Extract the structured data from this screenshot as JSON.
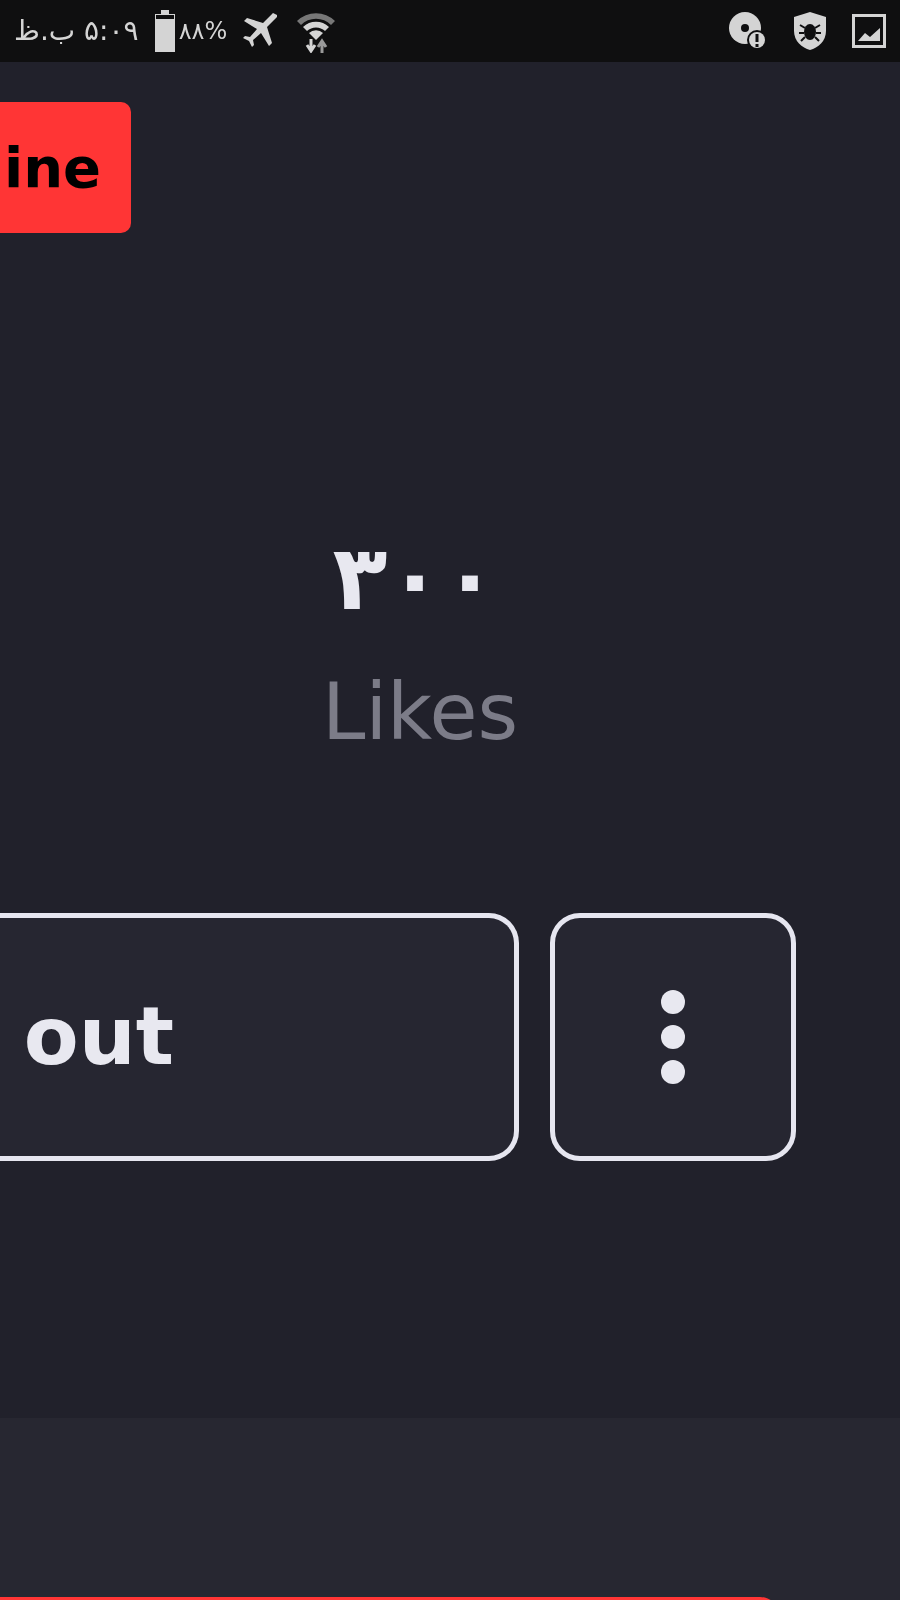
{
  "status_bar": {
    "time": "۵:۰۹ ب.ظ",
    "battery": {
      "text": "۸۸%",
      "level": 0.88
    }
  },
  "tag": {
    "label": "ine"
  },
  "stats": {
    "value": "۳۰۰",
    "label": "Likes"
  },
  "buttons": [
    {
      "kind": "text",
      "label": "out"
    },
    {
      "kind": "more"
    }
  ]
}
